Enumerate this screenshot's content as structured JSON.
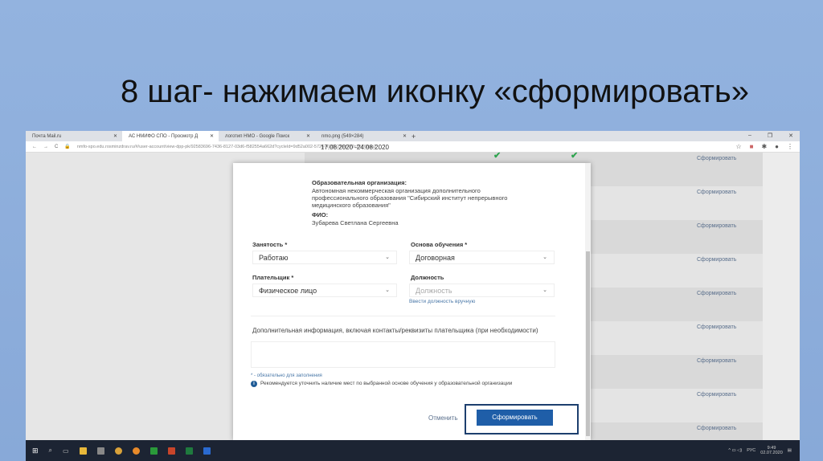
{
  "slide_title": "8 шаг- нажимаем иконку «сформировать»",
  "browser": {
    "tabs": [
      {
        "label": "Почта Mail.ru"
      },
      {
        "label": "АС НМИФО СПО - Просмотр Д"
      },
      {
        "label": "логотип НМО - Google Поиск"
      },
      {
        "label": "nmo.png (549×284)"
      }
    ],
    "new_tab": "+",
    "url": "nmfo-spo.edu.rosminzdrav.ru/#/user-account/view-dpp-pk/92583696-7436-8127-03d6-f582554a662d?cycleId=9d52a002-5726-4188-216d-6f2c2576baa2"
  },
  "background_page": {
    "date_range": "17.08.2020 -24.08.2020",
    "row_action": "Сформировать",
    "row_count": 9
  },
  "modal": {
    "org_label": "Образовательная организация:",
    "org_value": "Автономная некоммерческая организация дополнительного профессионального образования \"Сибирский институт непрерывного медицинского образования\"",
    "fio_label": "ФИО:",
    "fio_value": "Зубарева Светлана Сергеевна",
    "employment_label": "Занятость *",
    "employment_value": "Работаю",
    "basis_label": "Основа обучения *",
    "basis_value": "Договорная",
    "payer_label": "Плательщик *",
    "payer_value": "Физическое лицо",
    "position_label": "Должность",
    "position_placeholder": "Должность",
    "position_manual": "Ввести должность вручную",
    "extra_label": "Дополнительная информация, включая контакты/реквизиты плательщика (при необходимости)",
    "required_note": "* - обязательно для заполнения",
    "info_note": "Рекомендуется уточнить наличие мест по выбранной основе обучения у образовательной организации",
    "cancel": "Отменить",
    "submit": "Сформировать"
  },
  "taskbar": {
    "lang": "РУС",
    "time": "9:49",
    "date": "02.07.2020"
  }
}
